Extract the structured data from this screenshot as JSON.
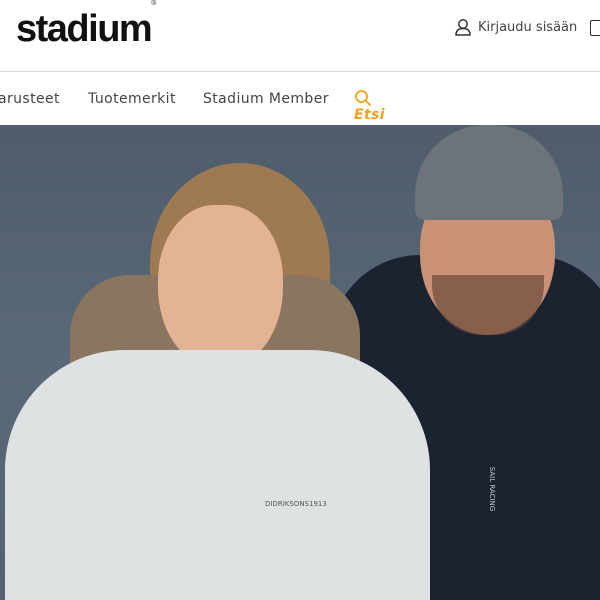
{
  "header": {
    "logo": "stadium",
    "logo_mark": "®",
    "login_label": "Kirjaudu sisään",
    "login_icon": "user-icon",
    "cart_icon": "shopping-bag-icon"
  },
  "nav": {
    "items": [
      {
        "label": "arusteet"
      },
      {
        "label": "Tuotemerkit"
      },
      {
        "label": "Stadium Member"
      }
    ],
    "search_label": "Etsi",
    "search_icon": "search-icon",
    "accent": "#f2a21a"
  },
  "hero": {
    "alt": "Woman in white parka with fur hood and man in beanie and dark down jacket",
    "jacket_brand_1": "DIDRIKSONS1913",
    "jacket_brand_2": "SAIL RACING"
  }
}
